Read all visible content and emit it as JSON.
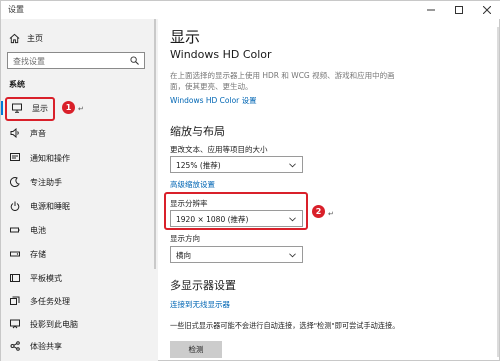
{
  "window": {
    "title": "设置",
    "controls": {
      "minimize": "minimize-icon",
      "maximize": "maximize-icon",
      "close": "close-icon"
    }
  },
  "sidebar": {
    "home_label": "主页",
    "search_placeholder": "查找设置",
    "section_title": "系统",
    "items": [
      {
        "label": "显示",
        "icon": "monitor-icon",
        "active": true
      },
      {
        "label": "声音",
        "icon": "speaker-icon"
      },
      {
        "label": "通知和操作",
        "icon": "notification-icon"
      },
      {
        "label": "专注助手",
        "icon": "moon-icon"
      },
      {
        "label": "电源和睡眠",
        "icon": "power-icon"
      },
      {
        "label": "电池",
        "icon": "battery-icon"
      },
      {
        "label": "存储",
        "icon": "storage-icon"
      },
      {
        "label": "平板模式",
        "icon": "tablet-icon"
      },
      {
        "label": "多任务处理",
        "icon": "multitask-icon"
      },
      {
        "label": "投影到此电脑",
        "icon": "project-icon"
      },
      {
        "label": "体验共享",
        "icon": "share-icon"
      }
    ]
  },
  "annotations": {
    "badge1": "1",
    "badge2": "2",
    "return_mark": "↵"
  },
  "main": {
    "page_title": "显示",
    "hdr_heading": "Windows HD Color",
    "hdr_desc": "在上面选择的显示器上使用 HDR 和 WCG 视频、游戏和应用中的画面，使其更亮、更生动。",
    "hdr_link": "Windows HD Color 设置",
    "scale_heading": "缩放与布局",
    "scale_label": "更改文本、应用等项目的大小",
    "scale_value": "125% (推荐)",
    "advanced_scale_link": "高级缩放设置",
    "resolution_label": "显示分辨率",
    "resolution_value": "1920 × 1080 (推荐)",
    "orientation_label": "显示方向",
    "orientation_value": "横向",
    "multi_heading": "多显示器设置",
    "wireless_link": "连接到无线显示器",
    "multi_desc": "一些旧式显示器可能不会进行自动连接，选择\"检测\"即可尝试手动连接。",
    "detect_button": "检测"
  },
  "colors": {
    "accent": "#0078d7",
    "highlight": "#d9202a",
    "link": "#0066b4",
    "sidebar_bg": "#f2f2f2"
  }
}
